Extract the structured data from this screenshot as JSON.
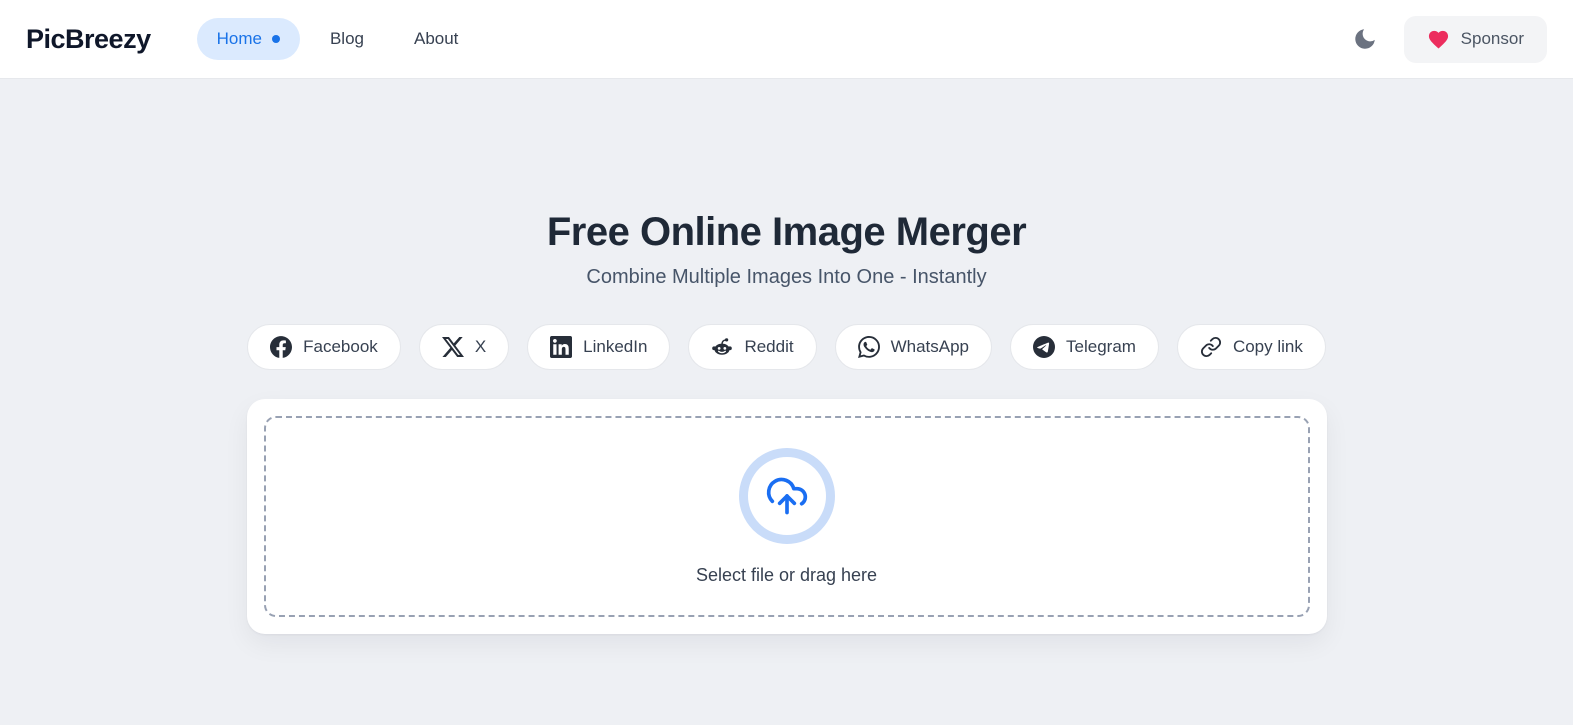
{
  "brand": {
    "name": "PicBreezy"
  },
  "nav": {
    "items": [
      {
        "label": "Home",
        "active": true
      },
      {
        "label": "Blog",
        "active": false
      },
      {
        "label": "About",
        "active": false
      }
    ]
  },
  "header_actions": {
    "theme_toggle_icon": "moon-icon",
    "sponsor_label": "Sponsor"
  },
  "hero": {
    "title": "Free Online Image Merger",
    "subtitle": "Combine Multiple Images Into One - Instantly"
  },
  "share": {
    "buttons": [
      {
        "icon": "facebook-icon",
        "label": "Facebook"
      },
      {
        "icon": "x-icon",
        "label": "X"
      },
      {
        "icon": "linkedin-icon",
        "label": "LinkedIn"
      },
      {
        "icon": "reddit-icon",
        "label": "Reddit"
      },
      {
        "icon": "whatsapp-icon",
        "label": "WhatsApp"
      },
      {
        "icon": "telegram-icon",
        "label": "Telegram"
      },
      {
        "icon": "link-icon",
        "label": "Copy link"
      }
    ]
  },
  "uploader": {
    "label": "Select file or drag here"
  },
  "colors": {
    "accent_blue": "#1a73e8",
    "upload_icon_blue": "#1a6ef2",
    "active_pill_bg": "#dbeafe",
    "upload_ring": "#c9dcf9",
    "heart_pink": "#ec2d5e",
    "page_bg": "#eef0f4",
    "header_bg": "#ffffff",
    "dashed_border": "#98a1b3"
  }
}
